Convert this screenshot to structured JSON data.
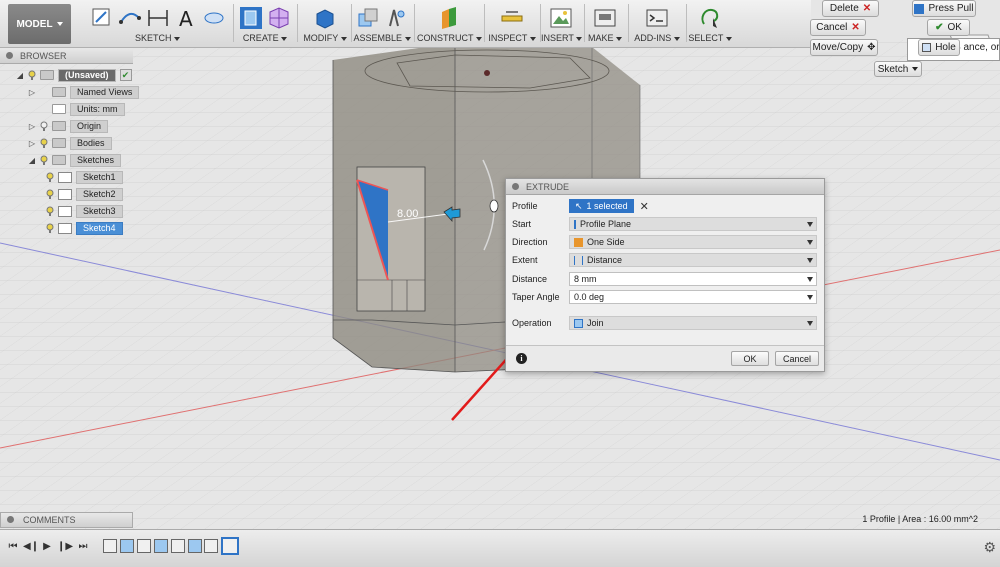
{
  "toolbar": {
    "model_label": "MODEL",
    "groups": [
      {
        "label": "SKETCH"
      },
      {
        "label": "CREATE"
      },
      {
        "label": "MODIFY"
      },
      {
        "label": "ASSEMBLE"
      },
      {
        "label": "CONSTRUCT"
      },
      {
        "label": "INSPECT"
      },
      {
        "label": "INSERT"
      },
      {
        "label": "MAKE"
      },
      {
        "label": "ADD-INS"
      },
      {
        "label": "SELECT"
      }
    ]
  },
  "right_panel": {
    "delete_label": "Delete",
    "press_pull_label": "Press Pull",
    "cancel_label": "Cancel",
    "ok_label": "OK",
    "move_copy_label": "Move/Copy",
    "hole_label": "Hole",
    "sketch_label": "Sketch",
    "tooltip_text": "S ance, or s"
  },
  "browser": {
    "title": "BROWSER",
    "root_label": "(Unsaved)",
    "items": [
      {
        "label": "Named Views"
      },
      {
        "label": "Units: mm"
      },
      {
        "label": "Origin"
      },
      {
        "label": "Bodies"
      },
      {
        "label": "Sketches"
      },
      {
        "label": "Sketch1"
      },
      {
        "label": "Sketch2"
      },
      {
        "label": "Sketch3"
      },
      {
        "label": "Sketch4"
      }
    ]
  },
  "canvas": {
    "dimension_value": "8.00"
  },
  "extrude_dialog": {
    "title": "EXTRUDE",
    "rows": {
      "profile": {
        "label": "Profile",
        "value": "1 selected"
      },
      "start": {
        "label": "Start",
        "value": "Profile Plane"
      },
      "direction": {
        "label": "Direction",
        "value": "One Side"
      },
      "extent": {
        "label": "Extent",
        "value": "Distance"
      },
      "distance": {
        "label": "Distance",
        "value": "8 mm"
      },
      "taper": {
        "label": "Taper Angle",
        "value": "0.0 deg"
      },
      "operation": {
        "label": "Operation",
        "value": "Join"
      }
    },
    "ok_label": "OK",
    "cancel_label": "Cancel"
  },
  "comments": {
    "title": "COMMENTS"
  },
  "status": {
    "text": "1 Profile | Area : 16.00 mm^2"
  },
  "colors": {
    "selection_blue": "#2f74c6",
    "arrow_red": "#e21b1b",
    "body_gray": "#8c877e"
  }
}
